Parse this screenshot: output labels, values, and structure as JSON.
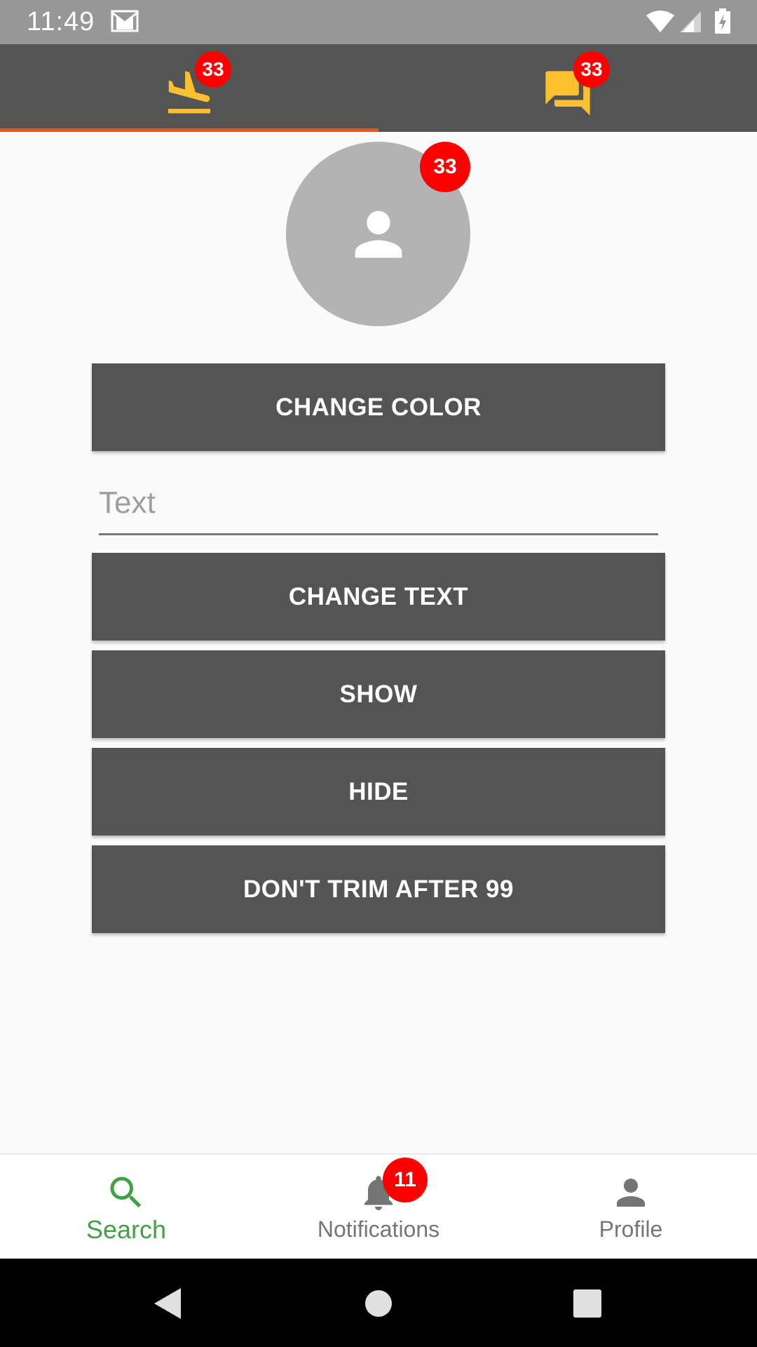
{
  "status_bar": {
    "time": "11:49",
    "icons": [
      "gmail-icon",
      "wifi-icon",
      "signal-icon",
      "battery-charging-icon"
    ]
  },
  "top_tabs": [
    {
      "icon": "flight-land-icon",
      "badge": "33",
      "selected": true
    },
    {
      "icon": "forum-icon",
      "badge": "33",
      "selected": false
    }
  ],
  "avatar": {
    "icon": "person-icon",
    "badge": "33"
  },
  "buttons": {
    "change_color": "CHANGE COLOR",
    "change_text": "CHANGE TEXT",
    "show": "SHOW",
    "hide": "HIDE",
    "dont_trim": "DON'T TRIM AFTER 99"
  },
  "text_field": {
    "placeholder": "Text",
    "value": ""
  },
  "bottom_nav": {
    "items": [
      {
        "label": "Search",
        "icon": "search-icon",
        "active": true
      },
      {
        "label": "Notifications",
        "icon": "bell-icon",
        "badge": "11",
        "active": false
      },
      {
        "label": "Profile",
        "icon": "person-icon",
        "active": false
      }
    ]
  },
  "colors": {
    "status_bar": "#979797",
    "tab_bar": "#545454",
    "tab_icon": "#fbc02d",
    "tab_indicator": "#f4511e",
    "badge": "#ff0000",
    "button": "#545454",
    "active_nav": "#43a047",
    "inactive_nav": "#757575"
  }
}
